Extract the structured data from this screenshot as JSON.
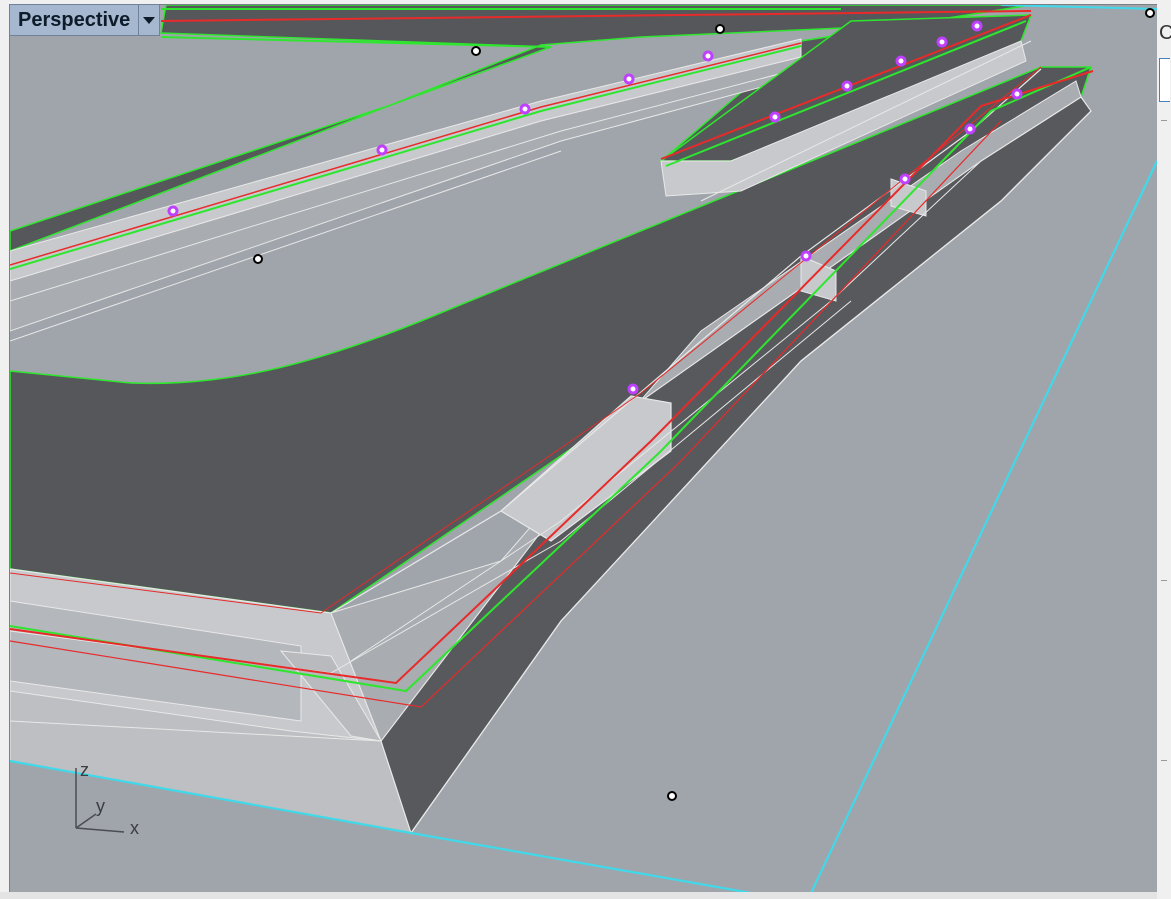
{
  "viewport": {
    "title": "Perspective",
    "menu_icon": "dropdown-triangle-icon",
    "background_color": "#a0a5ab"
  },
  "axis_gizmo": {
    "z_label": "z",
    "y_label": "y",
    "x_label": "x"
  },
  "colors": {
    "top_surface": "#56575a",
    "wall_light": "#c7c9cc",
    "wall_mid": "#a9acb0",
    "wall_dark": "#58595c",
    "edge_white": "#e8e8e8",
    "curve_green": "#2ee62e",
    "curve_red": "#e82a2a",
    "boundary_cyan": "#3fd9ea",
    "control_point_magenta": "#c040ff"
  },
  "right_panel": {
    "fragment_text": "C"
  }
}
